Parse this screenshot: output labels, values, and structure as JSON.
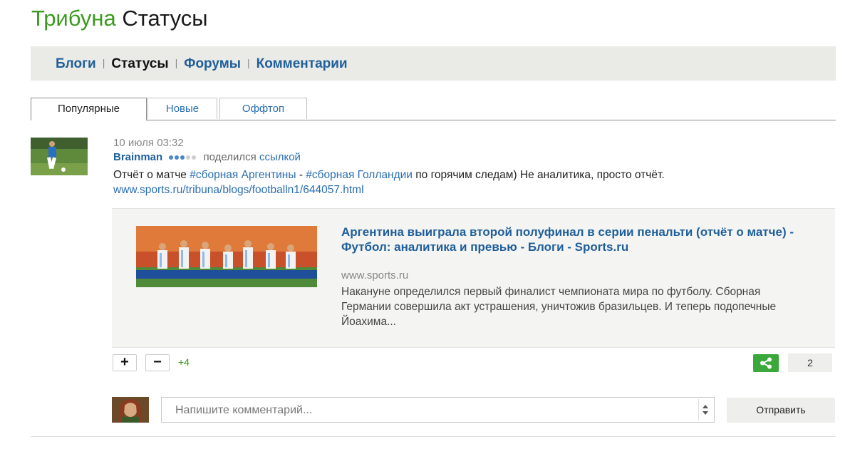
{
  "header": {
    "brand": "Трибуна",
    "section": "Статусы"
  },
  "nav": {
    "items": [
      {
        "label": "Блоги",
        "current": false
      },
      {
        "label": "Статусы",
        "current": true
      },
      {
        "label": "Форумы",
        "current": false
      },
      {
        "label": "Комментарии",
        "current": false
      }
    ],
    "separator": "|"
  },
  "tabs": [
    {
      "label": "Популярные",
      "active": true
    },
    {
      "label": "Новые",
      "active": false
    },
    {
      "label": "Оффтоп",
      "active": false
    }
  ],
  "post": {
    "date": "10 июля 03:32",
    "author": "Brainman",
    "rating_dots": {
      "filled": 3,
      "total": 5,
      "filled_color": "#4a86c8",
      "empty_color": "#cfcfcf"
    },
    "shared_text": "поделился",
    "shared_link": "ссылкой",
    "text_prefix": "Отчёт о матче ",
    "tag1": "#сборная Аргентины",
    "text_mid": " - ",
    "tag2": "#сборная Голландии",
    "text_suffix": " по горячим следам) Не аналитика, просто отчёт. ",
    "url": "www.sports.ru/tribuna/blogs/footballn1/644057.html"
  },
  "preview": {
    "title": "Аргентина выиграла второй полуфинал в серии пенальти (отчёт о матче) - Футбол: аналитика и превью - Блоги - Sports.ru",
    "domain": "www.sports.ru",
    "description": "Накануне определился первый финалист чемпионата мира по футболу. Сборная Германии совершила акт устрашения, уничтожив бразильцев. И теперь подопечные Йоахима..."
  },
  "actions": {
    "plus": "+",
    "minus": "−",
    "score": "+4",
    "share_icon": "share-icon",
    "share_count": "2"
  },
  "comment": {
    "placeholder": "Напишите комментарий...",
    "send_label": "Отправить"
  },
  "colors": {
    "brand_green": "#3a9a1e",
    "link_blue": "#1f5f9a",
    "share_green": "#3aa83a"
  }
}
